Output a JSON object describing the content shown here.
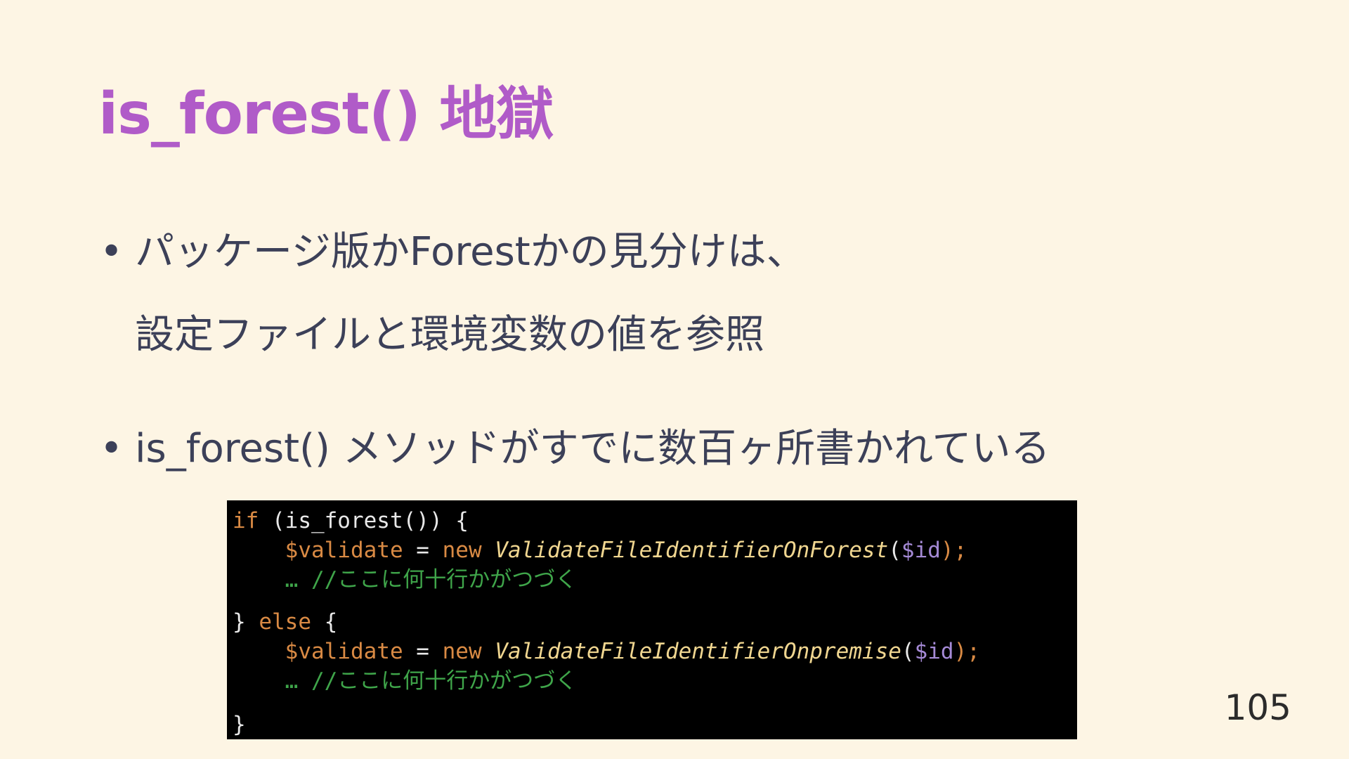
{
  "slide": {
    "title": "is_forest() 地獄",
    "bullets": [
      {
        "lines": [
          "パッケージ版かForestかの見分けは、",
          "設定ファイルと環境変数の値を参照"
        ]
      },
      {
        "lines": [
          "is_forest() メソッドがすでに数百ヶ所書かれている"
        ]
      }
    ],
    "bullet_symbol": "•",
    "page_number": "105"
  },
  "code": {
    "line1": {
      "kw": "if",
      "rest": " (is_forest()) {"
    },
    "line2": {
      "indent": "    ",
      "var": "$validate",
      "op": " = ",
      "new": "new",
      "cls": "ValidateFileIdentifierOnForest",
      "open": "(",
      "arg": "$id",
      "close": ");"
    },
    "line3": {
      "indent": "    ",
      "comment": "… //ここに何十行かがつづく"
    },
    "line4": {
      "open": "} ",
      "kw": "else",
      "rest": " {"
    },
    "line5": {
      "indent": "    ",
      "var": "$validate",
      "op": " = ",
      "new": "new",
      "cls": "ValidateFileIdentifierOnpremise",
      "open": "(",
      "arg": "$id",
      "close": ");"
    },
    "line6": {
      "indent": "    ",
      "comment": "… //ここに何十行かがつづく"
    },
    "line7": {
      "text": "}"
    }
  },
  "colors": {
    "background": "#fdf5e4",
    "title": "#b05bc8",
    "body_text": "#3c4058",
    "code_background": "#000000",
    "code_keyword": "#d98a44",
    "code_class": "#f0d690",
    "code_argument": "#a58ad6",
    "code_comment": "#3fa54a"
  }
}
